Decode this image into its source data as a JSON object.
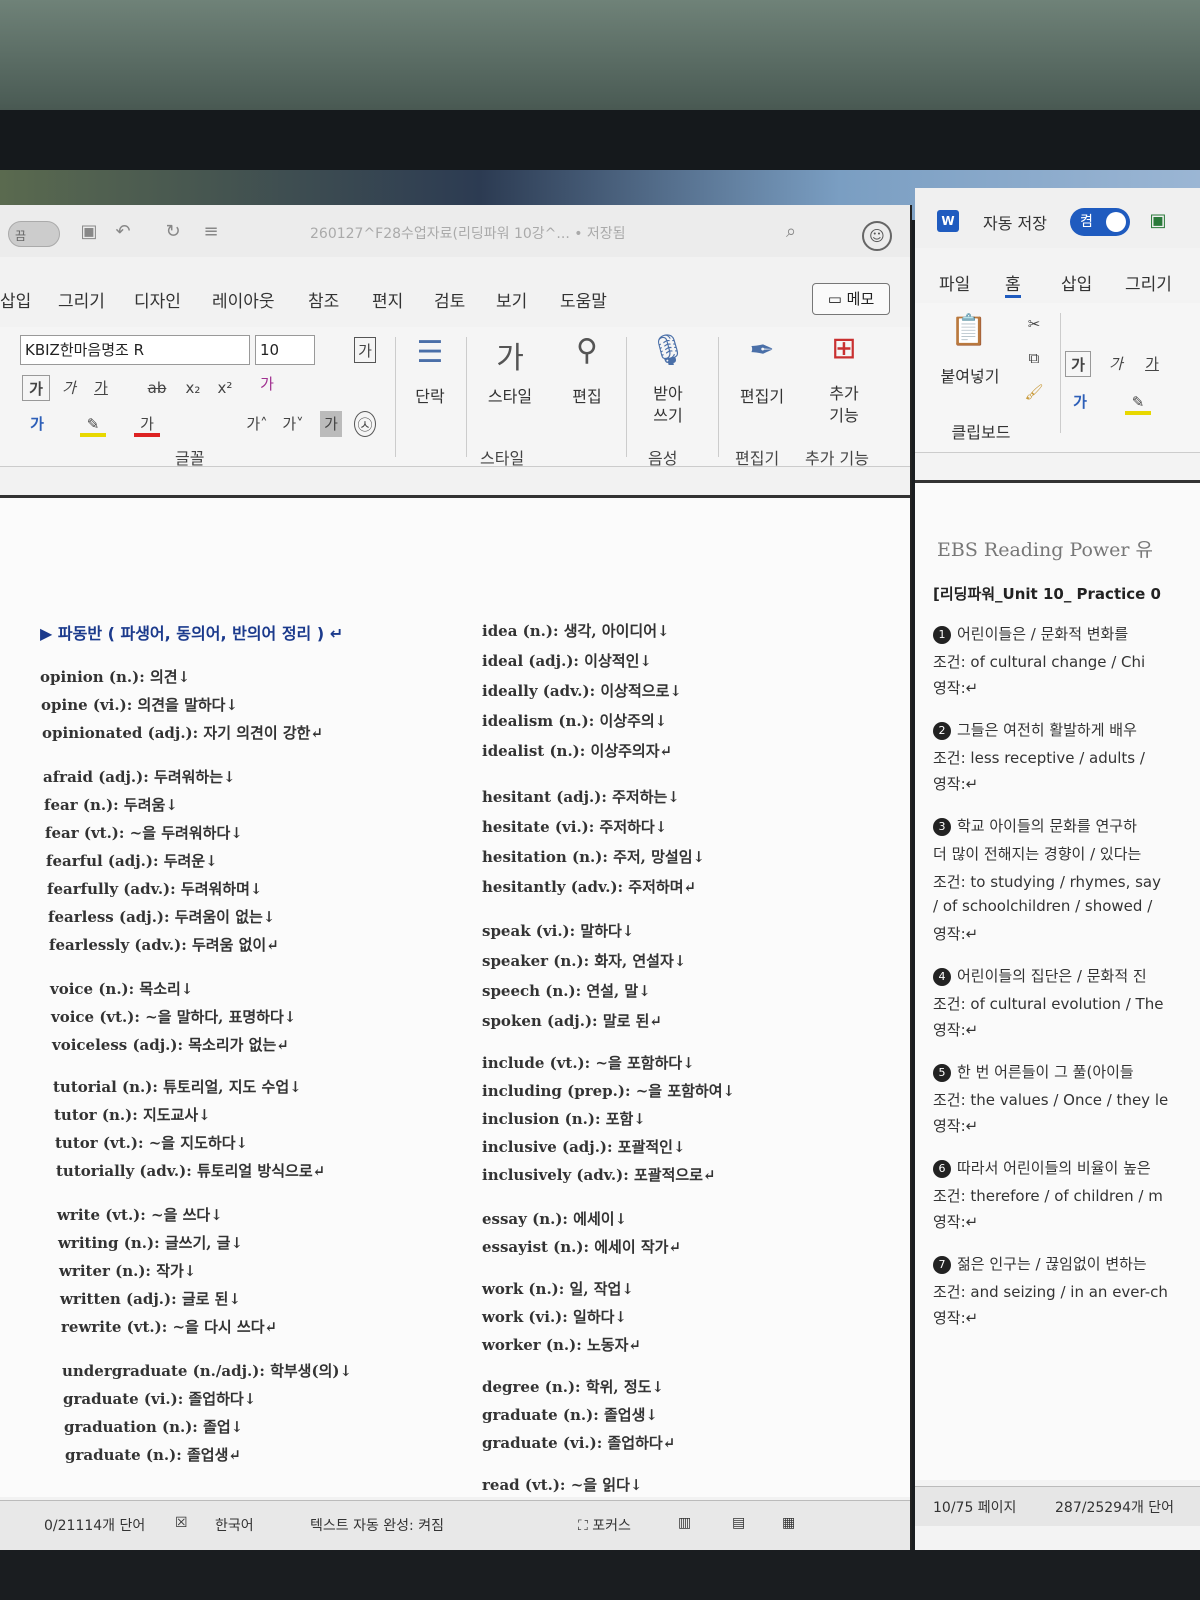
{
  "left_window": {
    "title": "260127^F28수업자료(리딩파워 10강^... • 저장됨",
    "toggle_label": "끔",
    "menu": [
      "삽입",
      "그리기",
      "디자인",
      "레이아웃",
      "참조",
      "편지",
      "검토",
      "보기",
      "도움말"
    ],
    "memo_label": "메모",
    "font_name": "KBIZ한마음명조 R",
    "font_size": "10",
    "ribbon": {
      "paragraph": "단락",
      "styles": "스타일",
      "edit": "편집",
      "dictate": "받아\n쓰기",
      "editor": "편집기",
      "addins": "추가\n기능"
    },
    "group_labels": {
      "font": "글꼴",
      "style": "스타일",
      "voice": "음성",
      "editor": "편집기",
      "addins": "추가 기능"
    },
    "heading": "▶ 파동반 ( 파생어, 동의어, 반의어 정리 ) ↵",
    "col1": [
      "opinion (n.): 의견↓",
      "opine (vi.): 의견을 말하다↓",
      "opinionated (adj.): 자기 의견이 강한↵",
      "afraid (adj.): 두려워하는↓",
      "fear (n.): 두려움↓",
      "fear (vt.): ~을 두려워하다↓",
      "fearful (adj.): 두려운↓",
      "fearfully (adv.): 두려워하며↓",
      "fearless (adj.): 두려움이 없는↓",
      "fearlessly (adv.): 두려움 없이↵",
      "voice (n.): 목소리↓",
      "voice (vt.): ~을 말하다, 표명하다↓",
      "voiceless (adj.): 목소리가 없는↵",
      "tutorial (n.): 튜토리얼, 지도 수업↓",
      "tutor (n.): 지도교사↓",
      "tutor (vt.): ~을 지도하다↓",
      "tutorially (adv.): 튜토리얼 방식으로↵",
      "write (vt.): ~을 쓰다↓",
      "writing (n.): 글쓰기, 글↓",
      "writer (n.): 작가↓",
      "written (adj.): 글로 된↓",
      "rewrite (vt.): ~을 다시 쓰다↵",
      "undergraduate (n./adj.): 학부생(의)↓",
      "graduate (vi.): 졸업하다↓",
      "graduation (n.): 졸업↓",
      "graduate (n.): 졸업생↵"
    ],
    "col2": [
      "idea (n.): 생각, 아이디어↓",
      "ideal (adj.): 이상적인↓",
      "ideally (adv.): 이상적으로↓",
      "idealism (n.): 이상주의↓",
      "idealist (n.): 이상주의자↵",
      "hesitant (adj.): 주저하는↓",
      "hesitate (vi.): 주저하다↓",
      "hesitation (n.): 주저, 망설임↓",
      "hesitantly (adv.): 주저하며↵",
      "speak (vi.): 말하다↓",
      "speaker (n.): 화자, 연설자↓",
      "speech (n.): 연설, 말↓",
      "spoken (adj.): 말로 된↵",
      "include (vt.): ~을 포함하다↓",
      "including (prep.): ~을 포함하여↓",
      "inclusion (n.): 포함↓",
      "inclusive (adj.): 포괄적인↓",
      "inclusively (adv.): 포괄적으로↵",
      "essay (n.): 에세이↓",
      "essayist (n.): 에세이 작가↵",
      "work (n.): 일, 작업↓",
      "work (vi.): 일하다↓",
      "worker (n.): 노동자↵",
      "degree (n.): 학위, 정도↓",
      "graduate (n.): 졸업생↓",
      "graduate (vi.): 졸업하다↵",
      "read (vt.): ~을 읽다↓"
    ],
    "status": {
      "words": "0/21114개 단어",
      "lang": "한국어",
      "autocomplete": "텍스트 자동 완성: 켜짐",
      "focus": "포커스"
    }
  },
  "right_window": {
    "autosave_label": "자동 저장",
    "toggle_label": "켬",
    "menu": [
      "파일",
      "홈",
      "삽입",
      "그리기"
    ],
    "paste_label": "붙여넣기",
    "clipboard_label": "클립보드",
    "ebs_title": "EBS Reading Power 유",
    "practice_title": "[리딩파워_Unit 10_ Practice 0",
    "items": [
      {
        "n": "1",
        "q": "어린이들은 / 문화적 변화를",
        "c": "조건: of cultural change / Chi",
        "a": "영작:↵"
      },
      {
        "n": "2",
        "q": "그들은 여전히 활발하게 배우",
        "c": "조건: less receptive / adults /",
        "a": "영작:↵"
      },
      {
        "n": "3",
        "q": "학교 아이들의 문화를 연구하",
        "q2": "더 많이 전해지는 경향이 / 있다는",
        "c": "조건: to studying / rhymes, say",
        "c2": "/ of schoolchildren / showed /",
        "a": "영작:↵"
      },
      {
        "n": "4",
        "q": "어린이들의 집단은 / 문화적 진",
        "c": "조건: of cultural evolution / The",
        "a": "영작:↵"
      },
      {
        "n": "5",
        "q": "한 번 어른들이 그 풀(아이들",
        "c": "조건: the values / Once / they le",
        "a": "영작:↵"
      },
      {
        "n": "6",
        "q": "따라서 어린이들의 비율이 높은",
        "c": "조건: therefore / of children / m",
        "a": "영작:↵"
      },
      {
        "n": "7",
        "q": "젊은 인구는 / 끊임없이 변하는",
        "c": "조건: and seizing / in an ever-ch",
        "a": "영작:↵"
      }
    ],
    "status": {
      "page": "10/75 페이지",
      "words": "287/25294개 단어"
    }
  }
}
